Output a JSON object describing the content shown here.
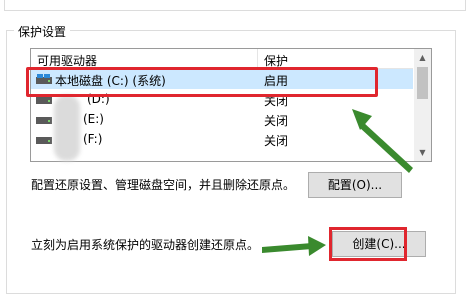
{
  "group": {
    "title": "保护设置"
  },
  "drive_list": {
    "headers": {
      "drive": "可用驱动器",
      "protection": "保护"
    },
    "rows": [
      {
        "drive": "本地磁盘 (C:) (系统)",
        "protection": "启用",
        "selected": true
      },
      {
        "drive": "(D:)",
        "protection": "关闭",
        "selected": false
      },
      {
        "drive": "(E:)",
        "protection": "关闭",
        "selected": false
      },
      {
        "drive": "(F:)",
        "protection": "关闭",
        "selected": false
      }
    ]
  },
  "configure": {
    "description": "配置还原设置、管理磁盘空间，并且删除还原点。",
    "button_label": "配置(O)..."
  },
  "create": {
    "description": "立刻为启用系统保护的驱动器创建还原点。",
    "button_label": "创建(C)..."
  },
  "colors": {
    "annotation_red": "#e0262e",
    "annotation_arrow_green": "#3a8a2e",
    "selection_blue": "#cce8ff"
  }
}
